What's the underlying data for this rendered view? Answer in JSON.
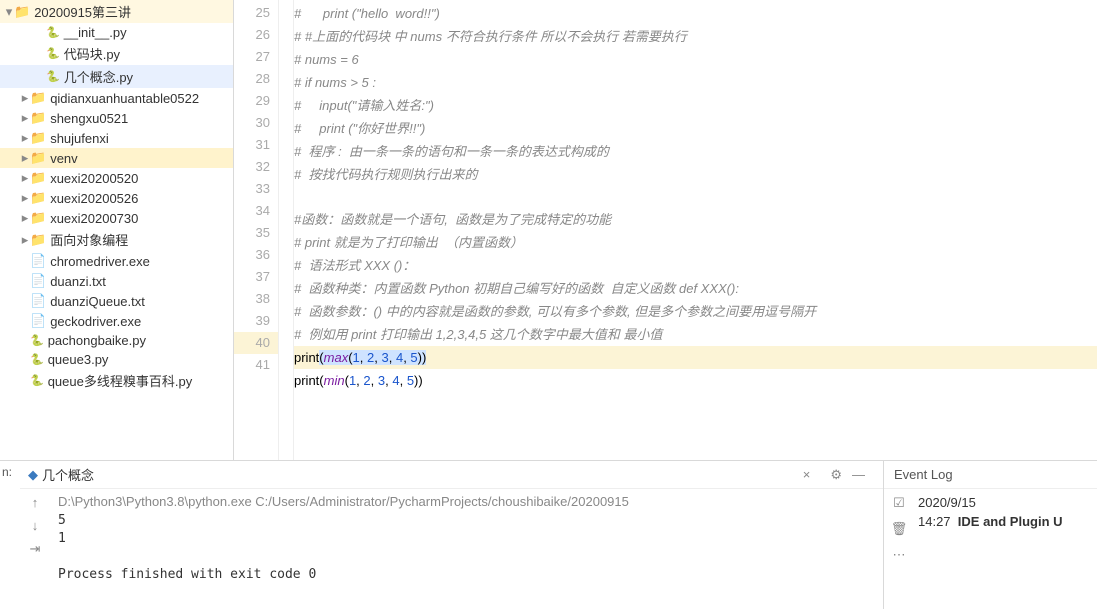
{
  "tree": {
    "root": "20200915第三讲",
    "root_children": [
      "__init__.py",
      "代码块.py",
      "几个概念.py"
    ],
    "folders": [
      "qidianxuanhuantable0522",
      "shengxu0521",
      "shujufenxi",
      "venv",
      "xuexi20200520",
      "xuexi20200526",
      "xuexi20200730",
      "面向对象编程"
    ],
    "files": [
      "chromedriver.exe",
      "duanzi.txt",
      "duanziQueue.txt",
      "geckodriver.exe",
      "pachongbaike.py",
      "queue3.py",
      "queue多线程糗事百科.py"
    ]
  },
  "code": {
    "lines": [
      {
        "n": 25,
        "type": "comment",
        "t": "#      print (\"hello  word!!\")"
      },
      {
        "n": 26,
        "type": "comment",
        "t": "# #上面的代码块 中 nums 不符合执行条件 所以不会执行 若需要执行"
      },
      {
        "n": 27,
        "type": "comment",
        "t": "# nums = 6"
      },
      {
        "n": 28,
        "type": "comment",
        "t": "# if nums > 5 :"
      },
      {
        "n": 29,
        "type": "comment",
        "t": "#     input(\"请输入姓名:\")"
      },
      {
        "n": 30,
        "type": "comment",
        "t": "#     print (\"你好世界!!\")"
      },
      {
        "n": 31,
        "type": "comment",
        "t": "#  程序 :  由一条一条的语句和一条一条的表达式构成的"
      },
      {
        "n": 32,
        "type": "comment",
        "t": "#  按找代码执行规则执行出来的"
      },
      {
        "n": 33,
        "type": "blank",
        "t": ""
      },
      {
        "n": 34,
        "type": "comment",
        "t": "#函数：函数就是一个语句,  函数是为了完成特定的功能"
      },
      {
        "n": 35,
        "type": "comment",
        "t": "# print 就是为了打印输出  （内置函数）"
      },
      {
        "n": 36,
        "type": "comment",
        "t": "#  语法形式 XXX ()："
      },
      {
        "n": 37,
        "type": "comment",
        "t": "#  函数种类：内置函数 Python 初期自己编写好的函数  自定义函数 def XXX():"
      },
      {
        "n": 38,
        "type": "comment",
        "t": "#  函数参数：() 中的内容就是函数的参数, 可以有多个参数, 但是多个参数之间要用逗号隔开"
      },
      {
        "n": 39,
        "type": "comment",
        "t": "#  例如用 print 打印输出 1,2,3,4,5 这几个数字中最大值和 最小值"
      },
      {
        "n": 40,
        "type": "code",
        "t": "print(max(1, 2, 3, 4, 5))",
        "cur": true,
        "sel": true
      },
      {
        "n": 41,
        "type": "code",
        "t": "print(min(1, 2, 3, 4, 5))"
      }
    ]
  },
  "run": {
    "label": "n:",
    "tab": "几个概念",
    "path": "D:\\Python3\\Python3.8\\python.exe C:/Users/Administrator/PycharmProjects/choushibaike/20200915",
    "out": [
      "5",
      "1",
      "",
      "Process finished with exit code 0"
    ]
  },
  "eventlog": {
    "title": "Event Log",
    "date": "2020/9/15",
    "time": "14:27",
    "msg": "IDE and Plugin U"
  },
  "watermark": ""
}
